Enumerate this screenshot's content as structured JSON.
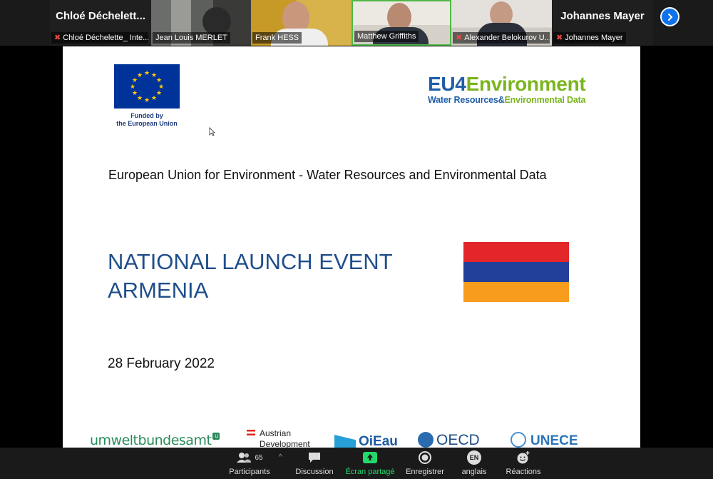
{
  "participants": [
    {
      "display_name": "Chloé  Déchelett...",
      "label": "Chloé Déchelette_ Inte...",
      "muted": true,
      "video": false
    },
    {
      "label": "Jean Louis MERLET",
      "muted": false,
      "video": true
    },
    {
      "label": "Frank HESS",
      "muted": false,
      "video": true
    },
    {
      "label": "Matthew Griffiths",
      "muted": false,
      "video": true
    },
    {
      "label": "Alexander Belokurov U...",
      "muted": true,
      "video": true
    },
    {
      "display_name": "Johannes Mayer",
      "label": "Johannes Mayer",
      "muted": true,
      "video": false
    }
  ],
  "slide": {
    "eu_caption_line1": "Funded by",
    "eu_caption_line2": "the European Union",
    "eu4env_prefix": "EU",
    "eu4env_number": "4",
    "eu4env_word": "Environment",
    "eu4env_sub_blue": "Water Resources",
    "eu4env_sub_amp": "&",
    "eu4env_sub_green": "Environmental Data",
    "subtitle": "European Union for Environment - Water Resources and Environmental Data",
    "event_title_line1": "NATIONAL LAUNCH EVENT",
    "event_title_line2": "ARMENIA",
    "date": "28 February 2022",
    "armenia_flag_colors": [
      "#e3262a",
      "#22409a",
      "#f79c1d"
    ],
    "partners": {
      "umwelt": "umweltbundesamt",
      "umwelt_mark": "u",
      "austrian_line1": "Austrian",
      "austrian_line2": "Development",
      "oieau": "OiEau",
      "oecd": "OECD",
      "unece": "UNECE"
    }
  },
  "toolbar": {
    "participants_label": "Participants",
    "participants_count": "65",
    "chat_label": "Discussion",
    "share_label": "Écran partagé",
    "record_label": "Enregistrer",
    "lang_badge": "EN",
    "lang_label": "anglais",
    "reactions_label": "Réactions"
  },
  "colors": {
    "zoom_blue": "#0e72ed",
    "share_green": "#23d96b",
    "mic_off_red": "#e8483f"
  }
}
